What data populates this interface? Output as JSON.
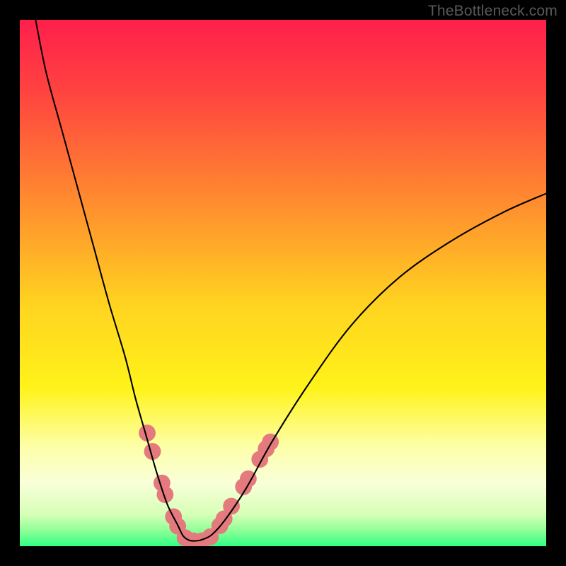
{
  "watermark": "TheBottleneck.com",
  "chart_data": {
    "type": "line",
    "title": "",
    "xlabel": "",
    "ylabel": "",
    "xlim": [
      0,
      100
    ],
    "ylim": [
      0,
      100
    ],
    "background": {
      "stops": [
        {
          "pct": 0,
          "color": "#ff1f4b"
        },
        {
          "pct": 14,
          "color": "#ff4440"
        },
        {
          "pct": 34,
          "color": "#ff8a2f"
        },
        {
          "pct": 54,
          "color": "#ffd320"
        },
        {
          "pct": 70,
          "color": "#fff31a"
        },
        {
          "pct": 81,
          "color": "#fdffa7"
        },
        {
          "pct": 88,
          "color": "#f9ffd9"
        },
        {
          "pct": 94,
          "color": "#d6ffb7"
        },
        {
          "pct": 97,
          "color": "#8fff97"
        },
        {
          "pct": 100,
          "color": "#2fff85"
        }
      ]
    },
    "series": [
      {
        "name": "bottleneck-curve",
        "x": [
          3,
          5,
          8,
          11,
          14,
          17,
          20,
          22,
          24,
          26,
          28,
          30,
          31,
          32,
          33,
          34.5,
          36.5,
          39,
          43,
          48,
          55,
          63,
          72,
          82,
          92,
          100
        ],
        "y": [
          100,
          90,
          79,
          68,
          57,
          46,
          36,
          28,
          21,
          14,
          8,
          4,
          2,
          1.2,
          1,
          1.2,
          2.2,
          5,
          11,
          20,
          31,
          42,
          51,
          58,
          63.5,
          67
        ]
      }
    ],
    "markers": {
      "color": "#e47a7d",
      "radius_frac": 0.016,
      "points": [
        {
          "x": 24.2,
          "y": 21.5
        },
        {
          "x": 25.2,
          "y": 18.0
        },
        {
          "x": 27.0,
          "y": 12.0
        },
        {
          "x": 27.6,
          "y": 9.8
        },
        {
          "x": 29.2,
          "y": 5.6
        },
        {
          "x": 30.0,
          "y": 3.8
        },
        {
          "x": 31.4,
          "y": 1.6
        },
        {
          "x": 33.0,
          "y": 1.0
        },
        {
          "x": 34.6,
          "y": 1.0
        },
        {
          "x": 36.2,
          "y": 1.8
        },
        {
          "x": 38.0,
          "y": 3.9
        },
        {
          "x": 38.8,
          "y": 5.2
        },
        {
          "x": 40.2,
          "y": 7.6
        },
        {
          "x": 42.5,
          "y": 11.3
        },
        {
          "x": 43.4,
          "y": 12.8
        },
        {
          "x": 45.6,
          "y": 16.5
        },
        {
          "x": 46.8,
          "y": 18.5
        },
        {
          "x": 47.6,
          "y": 19.8
        }
      ]
    }
  }
}
